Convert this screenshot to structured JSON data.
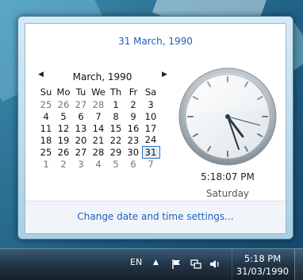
{
  "flyout": {
    "long_date": "31 March, 1990",
    "month_title": "March, 1990",
    "weekdays": [
      "Su",
      "Mo",
      "Tu",
      "We",
      "Th",
      "Fr",
      "Sa"
    ],
    "weeks": [
      [
        "25",
        "26",
        "27",
        "28",
        "1",
        "2",
        "3"
      ],
      [
        "4",
        "5",
        "6",
        "7",
        "8",
        "9",
        "10"
      ],
      [
        "11",
        "12",
        "13",
        "14",
        "15",
        "16",
        "17"
      ],
      [
        "18",
        "19",
        "20",
        "21",
        "22",
        "23",
        "24"
      ],
      [
        "25",
        "26",
        "27",
        "28",
        "29",
        "30",
        "31"
      ],
      [
        "1",
        "2",
        "3",
        "4",
        "5",
        "6",
        "7"
      ]
    ],
    "clock_time": "5:18:07 PM",
    "clock_day": "Saturday",
    "change_link": "Change date and time settings..."
  },
  "taskbar": {
    "language": "EN",
    "time": "5:18 PM",
    "date": "31/03/1990"
  },
  "icons": {
    "prev_month": "chevron-left-icon",
    "next_month": "chevron-right-icon",
    "tray_expand": "triangle-up-icon",
    "flag": "action-center-flag-icon",
    "network": "network-icon",
    "volume": "speaker-icon"
  },
  "colors": {
    "link_blue": "#1e5fbd",
    "selection_border": "#2d6fc3"
  }
}
